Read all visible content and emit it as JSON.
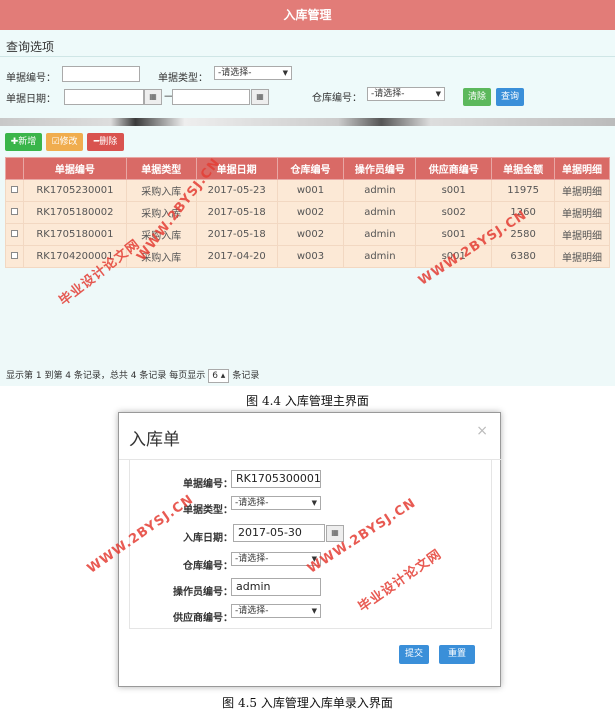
{
  "main": {
    "title": "入库管理",
    "query_title": "查询选项",
    "labels": {
      "doc_no": "单据编号：",
      "doc_type": "单据类型：",
      "doc_date": "单据日期：",
      "warehouse_no": "仓库编号：",
      "date_sep": "—"
    },
    "selects": {
      "doc_type": "-请选择-",
      "warehouse": "-请选择-"
    },
    "buttons": {
      "clear": "清除",
      "query": "查询",
      "add": "✚新增",
      "edit": "☑修改",
      "delete": "━删除"
    },
    "colors": {
      "header": "#d96a66",
      "row": "#fce9d6",
      "add": "#3ab54a",
      "edit": "#f0ad4e",
      "delete": "#d9534f",
      "clear": "#5cb85c",
      "query": "#3a8fd9"
    },
    "table": {
      "columns": [
        "单据编号",
        "单据类型",
        "单据日期",
        "仓库编号",
        "操作员编号",
        "供应商编号",
        "单据金额",
        "单据明细"
      ],
      "rows": [
        [
          "RK1705230001",
          "采购入库",
          "2017-05-23",
          "w001",
          "admin",
          "s001",
          "11975",
          "单据明细"
        ],
        [
          "RK1705180002",
          "采购入库",
          "2017-05-18",
          "w002",
          "admin",
          "s002",
          "1260",
          "单据明细"
        ],
        [
          "RK1705180001",
          "采购入库",
          "2017-05-18",
          "w002",
          "admin",
          "s001",
          "2580",
          "单据明细"
        ],
        [
          "RK1704200001",
          "采购入库",
          "2017-04-20",
          "w003",
          "admin",
          "s001",
          "6380",
          "单据明细"
        ]
      ]
    },
    "pager": {
      "text_before": "显示第 1 到第 4 条记录，总共 4 条记录 每页显示",
      "page_size": "6 ▴",
      "text_after": "条记录"
    }
  },
  "caption1": "图 4.4  入库管理主界面",
  "modal": {
    "title": "入库单",
    "close": "×",
    "labels": {
      "doc_no": "单据编号：",
      "doc_type": "单据类型：",
      "in_date": "入库日期：",
      "warehouse_no": "仓库编号：",
      "operator_no": "操作员编号：",
      "supplier_no": "供应商编号："
    },
    "values": {
      "doc_no": "RK1705300001",
      "in_date": "2017-05-30",
      "operator_no": "admin"
    },
    "selects": {
      "doc_type": "-请选择-",
      "warehouse": "-请选择-",
      "supplier": "-请选择-"
    },
    "buttons": {
      "submit": "提交",
      "reset": "重置"
    }
  },
  "caption2": "图 4.5  入库管理入库单录入界面",
  "watermark": {
    "site": "WWW.2BYSJ.CN",
    "cn": "毕业设计论文网"
  }
}
